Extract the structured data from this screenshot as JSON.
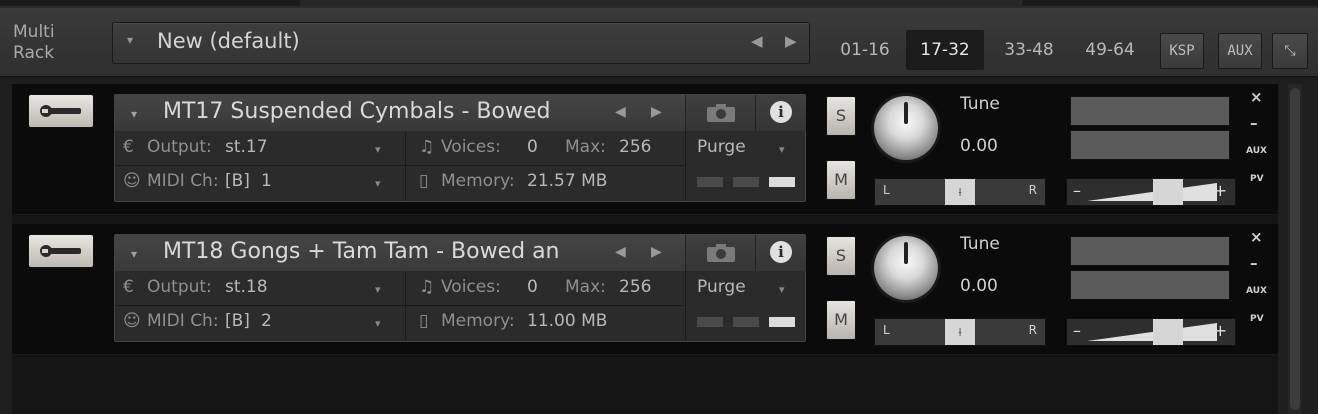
{
  "rack": {
    "title_line1": "Multi",
    "title_line2": "Rack",
    "preset_name": "New (default)",
    "banks": [
      "01-16",
      "17-32",
      "33-48",
      "49-64"
    ],
    "active_bank": "17-32",
    "buttons": {
      "ksp": "KSP",
      "aux": "AUX"
    }
  },
  "glyphs": {
    "dropdown": "▾",
    "arrow_left": "◀",
    "arrow_right": "▶",
    "info": "i",
    "output_icon": "€",
    "midi_icon": "☺",
    "voices_icon": "♫",
    "memory_icon": "▯",
    "close": "×",
    "minimize": "–",
    "collapse": "⤡",
    "plus": "+",
    "minus": "–"
  },
  "labels": {
    "output": "Output:",
    "midi": "MIDI Ch:",
    "voices": "Voices:",
    "max": "Max:",
    "memory": "Memory:",
    "purge": "Purge",
    "solo": "S",
    "mute": "M",
    "tune": "Tune",
    "pan_left": "L",
    "pan_right": "R",
    "aux": "AUX",
    "pv": "PV"
  },
  "instruments": [
    {
      "name": "MT17 Suspended Cymbals - Bowed",
      "output": "st.17",
      "midi_port": "[B]",
      "midi_channel": "1",
      "voices": "0",
      "max_voices": "256",
      "memory": "21.57 MB",
      "tune": "0.00"
    },
    {
      "name": "MT18 Gongs + Tam Tam - Bowed an",
      "output": "st.18",
      "midi_port": "[B]",
      "midi_channel": "2",
      "voices": "0",
      "max_voices": "256",
      "memory": "11.00 MB",
      "tune": "0.00"
    }
  ],
  "icons": [
    "wrench-icon",
    "camera-icon",
    "info-icon",
    "output-icon",
    "midi-icon",
    "voices-icon",
    "memory-icon",
    "close-icon",
    "minimize-icon",
    "collapse-icon"
  ]
}
